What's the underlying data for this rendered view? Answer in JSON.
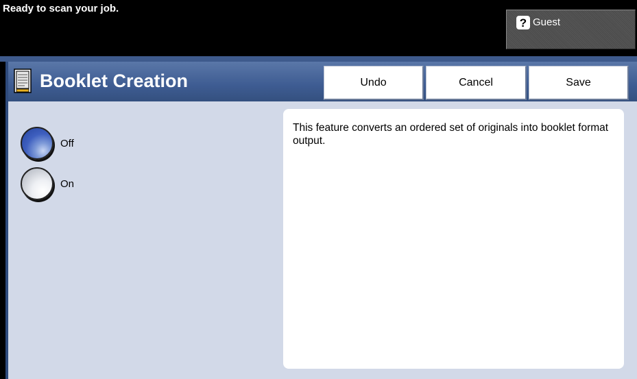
{
  "status": {
    "message": "Ready to scan your job."
  },
  "user": {
    "label": "Guest",
    "icon": "help-icon"
  },
  "screen": {
    "title": "Booklet Creation",
    "icon": "booklet-icon"
  },
  "toolbar": {
    "undo_label": "Undo",
    "cancel_label": "Cancel",
    "save_label": "Save"
  },
  "options": [
    {
      "label": "Off",
      "selected": true
    },
    {
      "label": "On",
      "selected": false
    }
  ],
  "info": {
    "description": "This feature converts an ordered set of originals into booklet format output."
  },
  "colors": {
    "header": "#3e5c92",
    "panel": "#d2d9e8",
    "selected_radio": "#3e5fbf"
  }
}
